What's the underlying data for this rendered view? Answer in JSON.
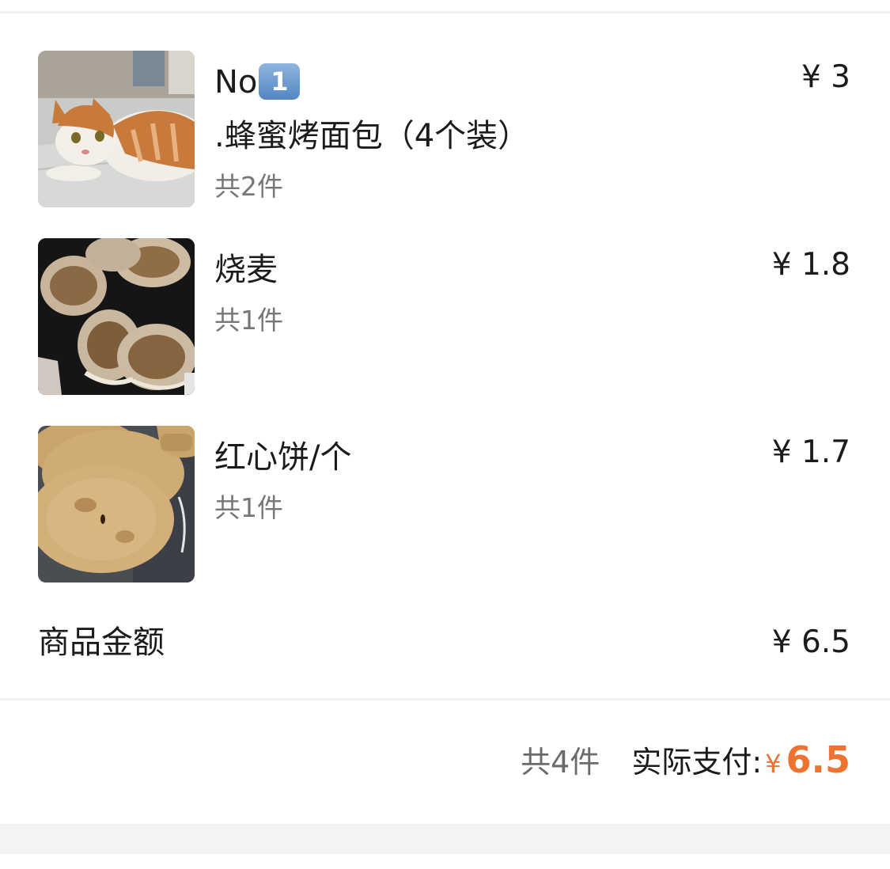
{
  "order": {
    "items": [
      {
        "title_prefix": "No",
        "title_badge": "1",
        "title_suffix": ".蜂蜜烤面包（4个装）",
        "count_text": "共2件",
        "price_text": "¥ 3",
        "image": "cat-photo"
      },
      {
        "title": "烧麦",
        "count_text": "共1件",
        "price_text": "¥ 1.8",
        "image": "shaomai-photo"
      },
      {
        "title": "红心饼/个",
        "count_text": "共1件",
        "price_text": "¥ 1.7",
        "image": "flatbread-photo"
      }
    ],
    "subtotal": {
      "label": "商品金额",
      "value": "¥ 6.5"
    },
    "total": {
      "count_text": "共4件",
      "label": "实际支付:",
      "currency": "¥",
      "value": "6.5"
    }
  },
  "colors": {
    "accent": "#ee7330",
    "muted_text": "#777777",
    "divider": "#f0f0f0"
  }
}
